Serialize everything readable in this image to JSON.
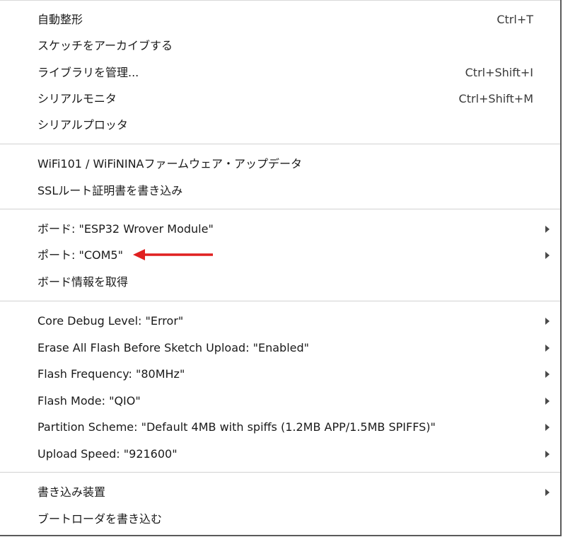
{
  "menu": {
    "group1": [
      {
        "label": "自動整形",
        "shortcut": "Ctrl+T"
      },
      {
        "label": "スケッチをアーカイブする",
        "shortcut": ""
      },
      {
        "label": "ライブラリを管理...",
        "shortcut": "Ctrl+Shift+I"
      },
      {
        "label": "シリアルモニタ",
        "shortcut": "Ctrl+Shift+M"
      },
      {
        "label": "シリアルプロッタ",
        "shortcut": ""
      }
    ],
    "group2": [
      {
        "label": "WiFi101 /  WiFiNINAファームウェア・アップデータ"
      },
      {
        "label": "SSLルート証明書を書き込み"
      }
    ],
    "group3": [
      {
        "label": "ボード: \"ESP32 Wrover Module\"",
        "submenu": true
      },
      {
        "label": "ポート: \"COM5\"",
        "submenu": true
      },
      {
        "label": "ボード情報を取得",
        "submenu": false
      }
    ],
    "group4": [
      {
        "label": "Core Debug Level: \"Error\"",
        "submenu": true
      },
      {
        "label": "Erase All Flash Before Sketch Upload: \"Enabled\"",
        "submenu": true
      },
      {
        "label": "Flash Frequency: \"80MHz\"",
        "submenu": true
      },
      {
        "label": "Flash Mode: \"QIO\"",
        "submenu": true
      },
      {
        "label": "Partition Scheme: \"Default 4MB with spiffs (1.2MB APP/1.5MB SPIFFS)\"",
        "submenu": true
      },
      {
        "label": "Upload Speed: \"921600\"",
        "submenu": true
      }
    ],
    "group5": [
      {
        "label": "書き込み装置",
        "submenu": true
      },
      {
        "label": "ブートローダを書き込む",
        "submenu": false
      }
    ]
  },
  "colors": {
    "annotation_arrow": "#e02020",
    "separator": "#d2d2d2",
    "text": "#1a1a1a"
  },
  "icons": {
    "submenu": "chevron-right-icon",
    "annotation": "red-arrow-icon"
  }
}
